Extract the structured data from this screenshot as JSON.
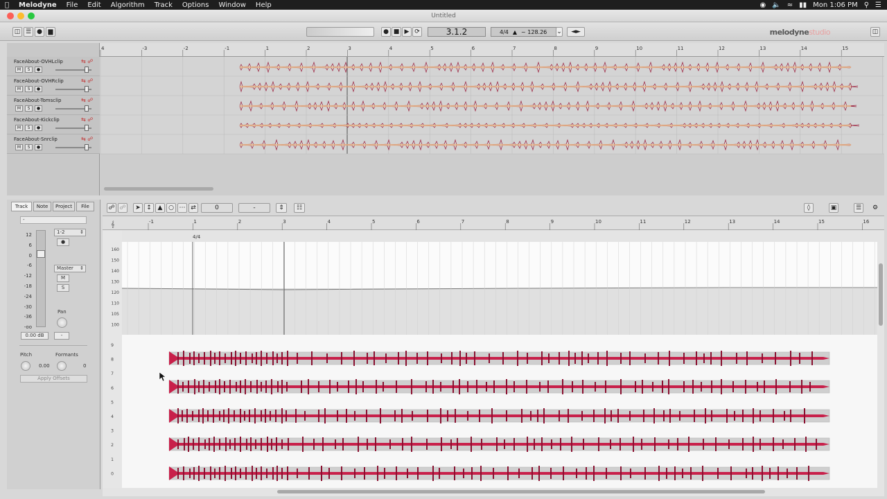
{
  "menubar": {
    "app": "Melodyne",
    "items": [
      "File",
      "Edit",
      "Algorithm",
      "Track",
      "Options",
      "Window",
      "Help"
    ],
    "clock": "Mon 1:06 PM"
  },
  "window": {
    "title": "Untitled"
  },
  "transport": {
    "position": "3.1.2",
    "time_signature": "4/4",
    "tempo": "~ 128.26"
  },
  "logo": {
    "main": "melodyne",
    "edition": "studio"
  },
  "arrange": {
    "ruler_labels": [
      "4",
      "-3",
      "-2",
      "-1",
      "1",
      "2",
      "3",
      "4",
      "5",
      "6",
      "7",
      "8",
      "9",
      "10",
      "11",
      "12",
      "13",
      "14",
      "15"
    ],
    "tracks": [
      {
        "name": "FaceAbout-OVHLclip",
        "mute": "M",
        "solo": "S"
      },
      {
        "name": "FaceAbout-OVHRclip",
        "mute": "M",
        "solo": "S"
      },
      {
        "name": "FaceAbout-Tomsclip",
        "mute": "M",
        "solo": "S"
      },
      {
        "name": "FaceAbout-Kickclip",
        "mute": "M",
        "solo": "S"
      },
      {
        "name": "FaceAbout-Snrclip",
        "mute": "M",
        "solo": "S"
      }
    ]
  },
  "inspector": {
    "tabs": [
      "Track",
      "Note",
      "Project",
      "File"
    ],
    "name_field": "-",
    "fader_scale": [
      "12",
      "6",
      "0",
      "-6",
      "-12",
      "-18",
      "-24",
      "-30",
      "-36",
      "-oo"
    ],
    "routing": "1-2",
    "output": "Master",
    "mute": "M",
    "solo": "S",
    "pan_label": "Pan",
    "volume": "0.00 dB",
    "volume_extra": "-",
    "pitch_label": "Pitch",
    "pitch_value": "0.00",
    "formants_label": "Formants",
    "formants_value": "0",
    "apply_button": "Apply Offsets"
  },
  "editor": {
    "field1": "0",
    "field2": "-",
    "ruler_labels": [
      "-1",
      "1",
      "2",
      "3",
      "4",
      "5",
      "6",
      "7",
      "8",
      "9",
      "10",
      "11",
      "12",
      "13",
      "14",
      "15",
      "16"
    ],
    "time_sig_marker": "4/4",
    "tempo_scale": [
      "160",
      "150",
      "140",
      "130",
      "120",
      "110",
      "105",
      "100"
    ],
    "pitch_scale": [
      "9",
      "8",
      "7",
      "6",
      "5",
      "4",
      "3",
      "2",
      "1",
      "0"
    ]
  },
  "colors": {
    "blob": "#c8204a",
    "blob_dark": "#8a1030",
    "waveform_fill": "#e9b98a",
    "waveform_line": "#a0304a",
    "accent_red": "#c03030"
  }
}
